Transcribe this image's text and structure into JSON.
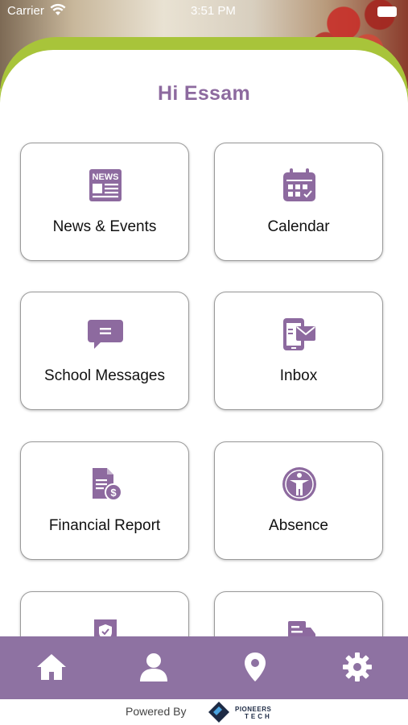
{
  "status_bar": {
    "carrier": "Carrier",
    "time": "3:51 PM"
  },
  "greeting": "Hi Essam",
  "tiles": [
    {
      "label": "News & Events",
      "icon": "news-icon"
    },
    {
      "label": "Calendar",
      "icon": "calendar-icon"
    },
    {
      "label": "School Messages",
      "icon": "message-icon"
    },
    {
      "label": "Inbox",
      "icon": "inbox-icon"
    },
    {
      "label": "Financial Report",
      "icon": "financial-report-icon"
    },
    {
      "label": "Absence",
      "icon": "absence-icon"
    },
    {
      "label": "",
      "icon": "certificate-icon"
    },
    {
      "label": "",
      "icon": "bus-icon"
    }
  ],
  "nav": [
    "home-icon",
    "profile-icon",
    "location-icon",
    "settings-icon"
  ],
  "footer": {
    "powered_by": "Powered By",
    "brand": "PIONEERS",
    "brand_sub": "TECH"
  },
  "colors": {
    "accent": "#8d6a9f",
    "nav": "#8e72a2",
    "arc": "#a8c43a"
  }
}
